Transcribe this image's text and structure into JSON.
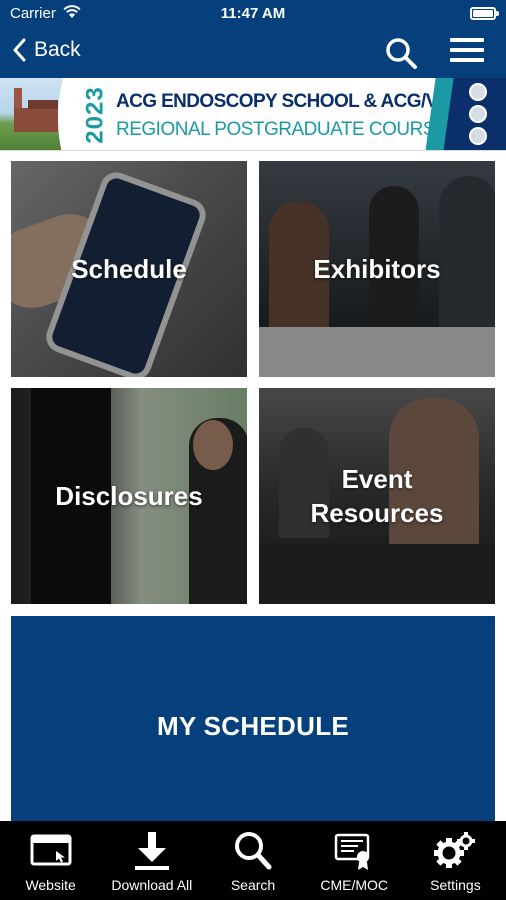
{
  "status_bar": {
    "carrier": "Carrier",
    "time": "11:47 AM",
    "battery_level": 1.0
  },
  "nav": {
    "back_label": "Back",
    "search_icon": "search-icon",
    "menu_icon": "hamburger-menu-icon"
  },
  "banner": {
    "year": "2023",
    "line1": "ACG ENDOSCOPY SCHOOL & ACG/VGS/ODSGNA",
    "line2": "REGIONAL POSTGRADUATE COURSE"
  },
  "tiles": [
    {
      "label": "Schedule"
    },
    {
      "label": "Exhibitors"
    },
    {
      "label": "Disclosures"
    },
    {
      "label": "Event\nResources"
    }
  ],
  "my_schedule_label": "MY SCHEDULE",
  "tabbar": [
    {
      "label": "Website",
      "icon": "browser-window-icon"
    },
    {
      "label": "Download All",
      "icon": "download-icon"
    },
    {
      "label": "Search",
      "icon": "search-icon"
    },
    {
      "label": "CME/MOC",
      "icon": "certificate-icon"
    },
    {
      "label": "Settings",
      "icon": "gears-icon"
    }
  ],
  "colors": {
    "primary_blue": "#05407c",
    "accent_teal": "#1b9aa6",
    "tabbar_bg": "#000000"
  }
}
